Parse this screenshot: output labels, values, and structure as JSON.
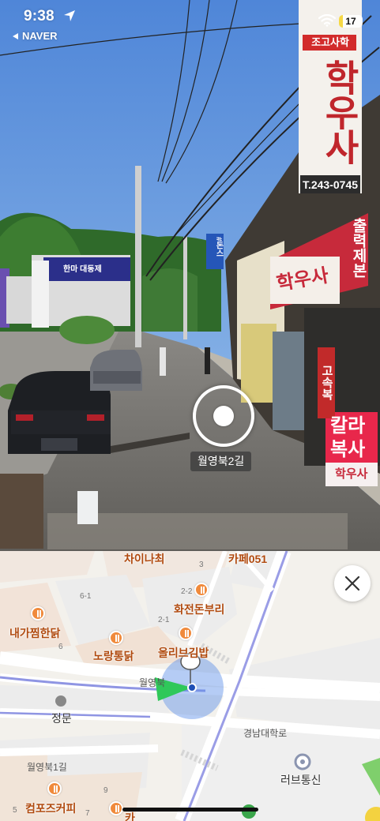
{
  "status": {
    "time": "9:38",
    "back_app": "NAVER",
    "battery": "17",
    "battery_level": 0.17
  },
  "street": {
    "signs": {
      "shop_vertical": "학우사",
      "shop_vertical_top": "조고사학",
      "phone": "T.243-0745",
      "banner_shop": "학우사",
      "banner_red": "출력제본",
      "side_sign": "고속복",
      "kalla_line1": "칼라",
      "kalla_line2": "복사",
      "kalla_line3": "학우사",
      "blue_small": "#돈스",
      "hall_banner": "한마 대동제"
    },
    "road_name": "월영북2길"
  },
  "map": {
    "labels": {
      "chinachi": "차이나최",
      "cafe051": "카페051",
      "hwajeon": "화전돈부리",
      "naega": "내가찜한닭",
      "norang": "노랑통닭",
      "olleebeu": "올리브김밥",
      "wolyeong_road": "월영북",
      "jeongmun": "정문",
      "kyungnam_road": "경남대학로",
      "lovetong": "러브통신",
      "wolyeongbuk1": "월영북1길",
      "compose": "컴포즈커피",
      "bottom_partial": "카"
    },
    "numbers": {
      "n3": "3",
      "n22": "2-2",
      "n61": "6-1",
      "n21": "2-1",
      "n6": "6",
      "n9": "9",
      "n5": "5",
      "n7": "7"
    },
    "close_icon": "close-icon"
  }
}
